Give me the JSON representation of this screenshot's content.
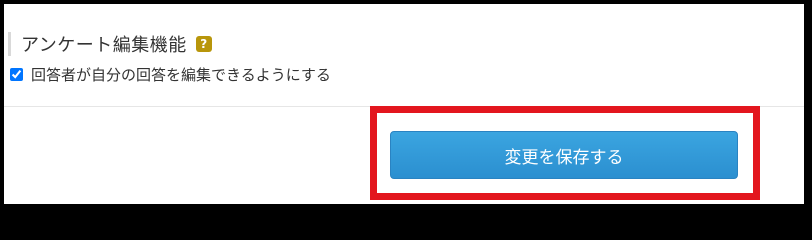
{
  "section": {
    "title": "アンケート編集機能",
    "help_icon": "question-mark-icon",
    "help_icon_glyph": "?",
    "help_icon_color": "#b8960b"
  },
  "option": {
    "label": "回答者が自分の回答を編集できるようにする",
    "checked": true
  },
  "actions": {
    "save_label": "変更を保存する",
    "button_color": "#2d94d4",
    "highlight_color": "#e3161e"
  }
}
